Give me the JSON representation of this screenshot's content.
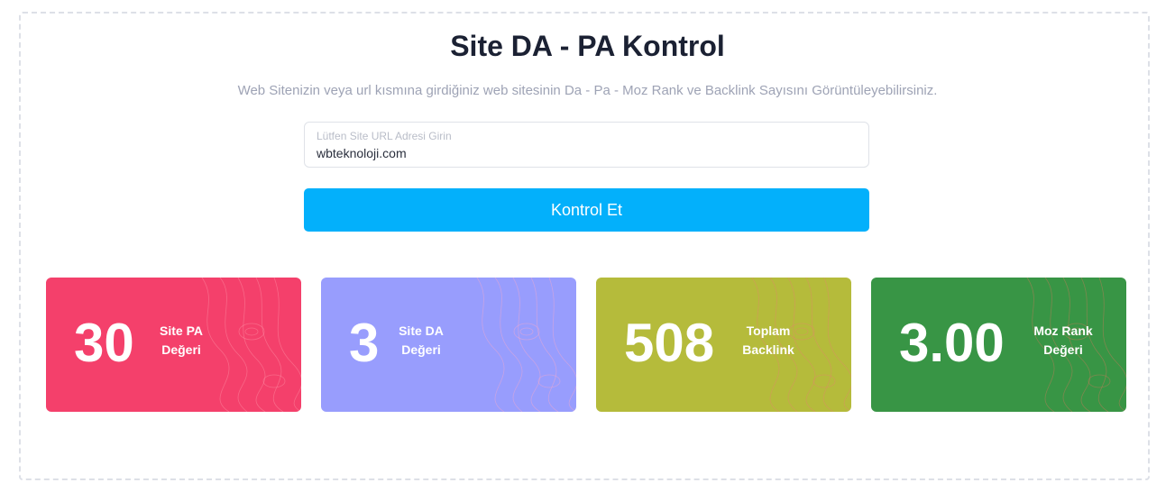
{
  "page": {
    "title": "Site DA - PA Kontrol",
    "subtitle": "Web Sitenizin veya url kısmına girdiğiniz web sitesinin Da - Pa - Moz Rank ve Backlink Sayısını Görüntüleyebilirsiniz."
  },
  "form": {
    "url_label": "Lütfen Site URL Adresi Girin",
    "url_value": "wbteknoloji.com",
    "submit_label": "Kontrol Et"
  },
  "stats": [
    {
      "value": "30",
      "label_line1": "Site PA",
      "label_line2": "Değeri",
      "color": "#f4406b"
    },
    {
      "value": "3",
      "label_line1": "Site DA",
      "label_line2": "Değeri",
      "color": "#989dfd"
    },
    {
      "value": "508",
      "label_line1": "Toplam",
      "label_line2": "Backlink",
      "color": "#b5bb3b"
    },
    {
      "value": "3.00",
      "label_line1": "Moz Rank",
      "label_line2": "Değeri",
      "color": "#389545"
    }
  ]
}
